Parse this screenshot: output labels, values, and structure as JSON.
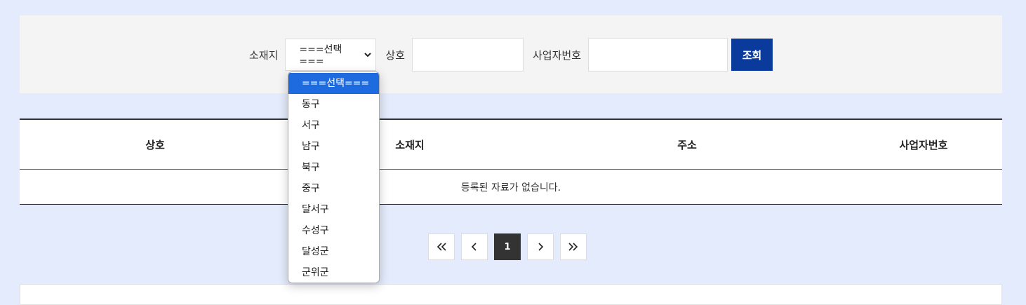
{
  "search": {
    "location_label": "소재지",
    "location_selected": "===선택===",
    "name_label": "상호",
    "name_value": "",
    "biz_label": "사업자번호",
    "biz_value": "",
    "search_button": "조회"
  },
  "dropdown": {
    "options": [
      "===선택===",
      "동구",
      "서구",
      "남구",
      "북구",
      "중구",
      "달서구",
      "수성구",
      "달성군",
      "군위군"
    ],
    "selected_index": 0
  },
  "table": {
    "headers": [
      "상호",
      "소재지",
      "주소",
      "사업자번호"
    ],
    "empty_message": "등록된 자료가 없습니다."
  },
  "pagination": {
    "current_page": "1",
    "icons": {
      "first": "double-chevron-left-icon",
      "prev": "chevron-left-icon",
      "next": "chevron-right-icon",
      "last": "double-chevron-right-icon"
    }
  },
  "colors": {
    "background": "#e3ebfc",
    "search_button": "#0a3a9c",
    "selected_option": "#1e6be0",
    "active_page": "#333333"
  }
}
